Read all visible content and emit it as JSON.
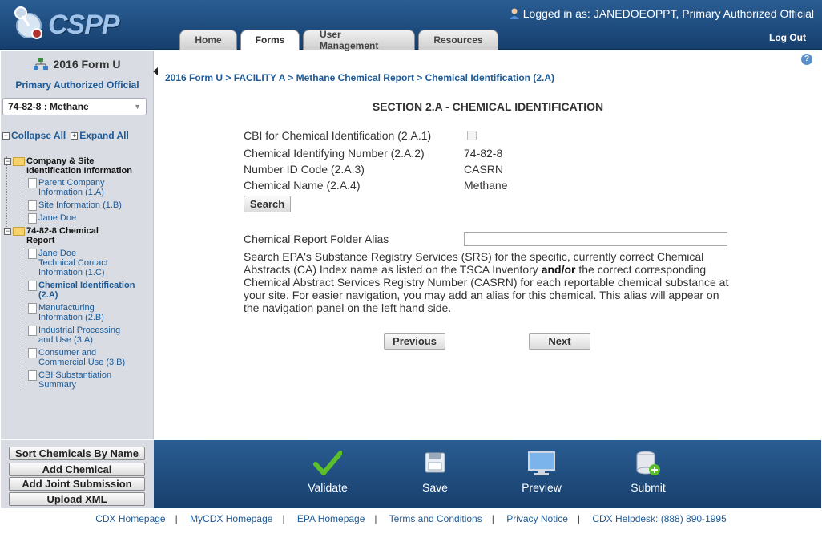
{
  "header": {
    "app_name": "CSPP",
    "logged_in_prefix": "Logged in as:",
    "user": "JANEDOEOPPT, Primary Authorized Official",
    "logout": "Log Out",
    "tabs": [
      {
        "label": "Home",
        "active": false
      },
      {
        "label": "Forms",
        "active": true
      },
      {
        "label": "User Management",
        "active": false
      },
      {
        "label": "Resources",
        "active": false
      }
    ]
  },
  "sidebar": {
    "form_title": "2016 Form U",
    "role": "Primary Authorized Official",
    "chemical_select": "74-82-8 : Methane",
    "collapse_all": "Collapse All",
    "expand_all": "Expand All",
    "tree": {
      "company": {
        "label": "Company & Site Identification Information",
        "children": [
          "Parent Company Information (1.A)",
          "Site Information (1.B)",
          "Jane Doe"
        ]
      },
      "chemical": {
        "label": "74-82-8 Chemical Report",
        "children": [
          "Jane Doe Technical Contact Information (1.C)",
          "Chemical Identification (2.A)",
          "Manufacturing Information (2.B)",
          "Industrial Processing and Use (3.A)",
          "Consumer and Commercial Use (3.B)",
          "CBI Substantiation Summary"
        ]
      }
    },
    "buttons": [
      "Sort Chemicals By Name",
      "Add Chemical",
      "Add Joint Submission",
      "Upload XML"
    ]
  },
  "main": {
    "breadcrumb": "2016 Form U > FACILITY A > Methane Chemical Report > Chemical Identification (2.A)",
    "section_title": "SECTION 2.A - CHEMICAL IDENTIFICATION",
    "fields": {
      "cbi_label": "CBI for Chemical Identification (2.A.1)",
      "cbi_checked": false,
      "id_number_label": "Chemical Identifying Number (2.A.2)",
      "id_number_value": "74-82-8",
      "id_code_label": "Number ID Code (2.A.3)",
      "id_code_value": "CASRN",
      "chem_name_label": "Chemical Name (2.A.4)",
      "chem_name_value": "Methane"
    },
    "search_button": "Search",
    "alias_label": "Chemical Report Folder Alias",
    "alias_value": "",
    "help_text_part1": "Search EPA's Substance Registry Services (SRS) for the specific, currently correct Chemical Abstracts (CA) Index name as listed on the TSCA Inventory ",
    "help_text_bold": "and/or",
    "help_text_part2": " the correct corresponding Chemical Abstract Services Registry Number (CASRN) for each reportable chemical substance at your site. For easier navigation, you may add an alias for this chemical. This alias will appear on the navigation panel on the left hand side.",
    "previous_button": "Previous",
    "next_button": "Next"
  },
  "actions": [
    {
      "label": "Validate",
      "icon": "checkmark-icon"
    },
    {
      "label": "Save",
      "icon": "floppy-disk-icon"
    },
    {
      "label": "Preview",
      "icon": "monitor-icon"
    },
    {
      "label": "Submit",
      "icon": "database-add-icon"
    }
  ],
  "footer": {
    "links": [
      "CDX Homepage",
      "MyCDX Homepage",
      "EPA Homepage",
      "Terms and Conditions",
      "Privacy Notice",
      "CDX Helpdesk: (888) 890-1995"
    ]
  },
  "colors": {
    "header_blue": "#1f4f84",
    "link_blue": "#1d5a96",
    "sidebar_gray": "#d9dde3",
    "check_green": "#5bbf2a"
  }
}
